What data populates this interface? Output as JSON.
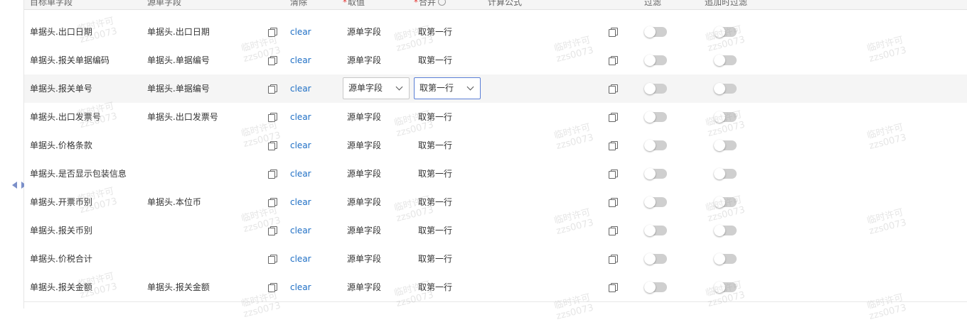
{
  "header": {
    "col_target": "目标单字段",
    "col_source": "源单字段",
    "col_clear": "清除",
    "col_value": "取值",
    "col_merge": "合并",
    "col_formula": "计算公式",
    "col_filter": "过滤",
    "col_add_filter": "追加时过滤"
  },
  "rows": [
    {
      "target": "单据头.出口日期",
      "source": "单据头.出口日期",
      "clear": "clear",
      "value": "源单字段",
      "merge": "取第一行",
      "filter_on": false,
      "add_filter_on": false
    },
    {
      "target": "单据头.报关单据编码",
      "source": "单据头.单据编号",
      "clear": "clear",
      "value": "源单字段",
      "merge": "取第一行",
      "filter_on": false,
      "add_filter_on": false
    },
    {
      "target": "单据头.报关单号",
      "source": "单据头.单据编号",
      "clear": "clear",
      "value": "源单字段",
      "merge": "取第一行",
      "filter_on": false,
      "add_filter_on": false
    },
    {
      "target": "单据头.出口发票号",
      "source": "单据头.出口发票号",
      "clear": "clear",
      "value": "源单字段",
      "merge": "取第一行",
      "filter_on": false,
      "add_filter_on": false
    },
    {
      "target": "单据头.价格条款",
      "source": "",
      "clear": "clear",
      "value": "源单字段",
      "merge": "取第一行",
      "filter_on": false,
      "add_filter_on": false
    },
    {
      "target": "单据头.是否显示包装信息",
      "source": "",
      "clear": "clear",
      "value": "源单字段",
      "merge": "取第一行",
      "filter_on": false,
      "add_filter_on": false
    },
    {
      "target": "单据头.开票币别",
      "source": "单据头.本位币",
      "clear": "clear",
      "value": "源单字段",
      "merge": "取第一行",
      "filter_on": false,
      "add_filter_on": false
    },
    {
      "target": "单据头.报关币别",
      "source": "",
      "clear": "clear",
      "value": "源单字段",
      "merge": "取第一行",
      "filter_on": false,
      "add_filter_on": false
    },
    {
      "target": "单据头.价税合计",
      "source": "",
      "clear": "clear",
      "value": "源单字段",
      "merge": "取第一行",
      "filter_on": false,
      "add_filter_on": false
    },
    {
      "target": "单据头.报关金额",
      "source": "单据头.报关金额",
      "clear": "clear",
      "value": "源单字段",
      "merge": "取第一行",
      "filter_on": false,
      "add_filter_on": false
    }
  ],
  "watermark": {
    "line1": "临时许可",
    "line2": "zzs0073"
  },
  "icons": {
    "copy": "copy-icon",
    "splitter_left": "caret-left-icon",
    "splitter_right": "caret-right-icon",
    "info": "info-icon"
  },
  "colors": {
    "link": "#1f6fc5",
    "highlight_row": "#f5f5f5",
    "focus_border": "#5b7fd6",
    "toggle_off": "#cfcfcf"
  }
}
